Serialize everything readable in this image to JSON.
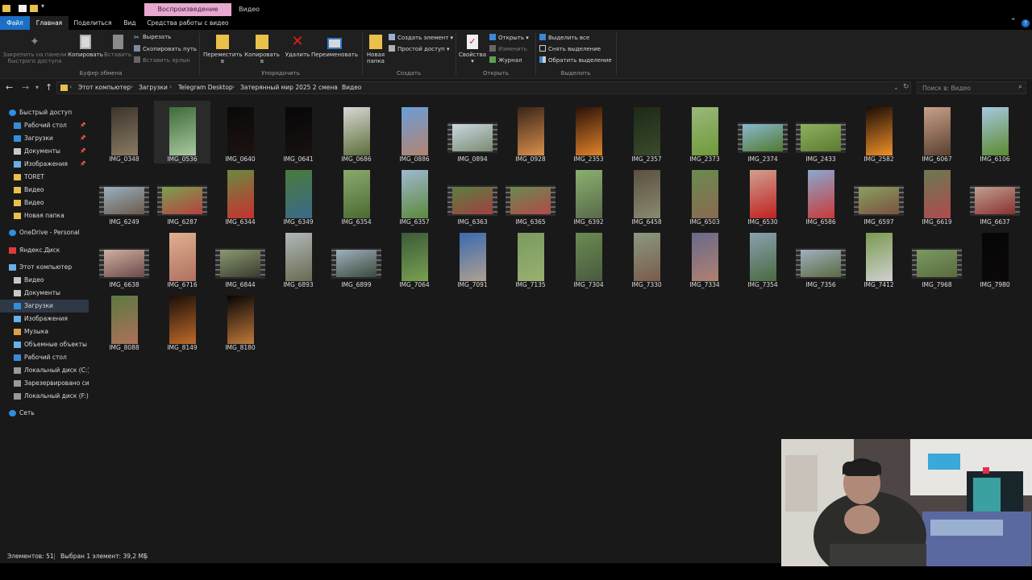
{
  "window": {
    "context_tab_group": "Воспроизведение",
    "context_tab_sub": "Видео"
  },
  "ribbon_tabs": [
    {
      "label": "Файл"
    },
    {
      "label": "Главная"
    },
    {
      "label": "Поделиться"
    },
    {
      "label": "Вид"
    },
    {
      "label": "Средства работы с видео"
    }
  ],
  "ribbon": {
    "clipboard": {
      "pin_label_1": "Закрепить на панели",
      "pin_label_2": "быстрого доступа",
      "copy": "Копировать",
      "paste": "Вставить",
      "cut": "Вырезать",
      "copy_path": "Скопировать путь",
      "paste_shortcut": "Вставить ярлык",
      "group": "Буфер обмена"
    },
    "organize": {
      "move_1": "Переместить",
      "move_2": "в",
      "copy_1": "Копировать",
      "copy_2": "в",
      "delete": "Удалить",
      "rename": "Переименовать",
      "group": "Упорядочить"
    },
    "create": {
      "new_folder_1": "Новая",
      "new_folder_2": "папка",
      "new_item": "Создать элемент",
      "easy_access": "Простой доступ",
      "group": "Создать"
    },
    "open": {
      "properties": "Свойства",
      "open": "Открыть",
      "edit": "Изменить",
      "history": "Журнал",
      "group": "Открыть"
    },
    "select": {
      "select_all": "Выделить все",
      "select_none": "Снять выделение",
      "invert": "Обратить выделение",
      "group": "Выделить"
    }
  },
  "address": {
    "crumbs": [
      "Этот компьютер",
      "Загрузки",
      "Telegram Desktop",
      "Затерянный мир 2025 2 смена",
      "Видео"
    ],
    "search_placeholder": "Поиск в: Видео"
  },
  "nav": [
    {
      "label": "Быстрый доступ",
      "icon": "star-icon"
    },
    {
      "label": "Рабочий стол",
      "icon": "desktop-icon",
      "pinned": true
    },
    {
      "label": "Загрузки",
      "icon": "download-icon",
      "pinned": true
    },
    {
      "label": "Документы",
      "icon": "documents-icon",
      "pinned": true
    },
    {
      "label": "Изображения",
      "icon": "pictures-icon",
      "pinned": true
    },
    {
      "label": "TORET",
      "icon": "folder-icon"
    },
    {
      "label": "Видео",
      "icon": "folder-icon"
    },
    {
      "label": "Видео",
      "icon": "folder-icon"
    },
    {
      "label": "Новая папка",
      "icon": "folder-icon"
    },
    {
      "label": "OneDrive - Personal",
      "icon": "cloud-icon"
    },
    {
      "label": "Яндекс.Диск",
      "icon": "yandex-disk-icon"
    },
    {
      "label": "Этот компьютер",
      "icon": "computer-icon"
    },
    {
      "label": "Видео",
      "icon": "videos-icon"
    },
    {
      "label": "Документы",
      "icon": "documents-icon"
    },
    {
      "label": "Загрузки",
      "icon": "download-icon",
      "selected": true
    },
    {
      "label": "Изображения",
      "icon": "pictures-icon"
    },
    {
      "label": "Музыка",
      "icon": "music-icon"
    },
    {
      "label": "Объемные объекты",
      "icon": "3d-objects-icon"
    },
    {
      "label": "Рабочий стол",
      "icon": "desktop-icon"
    },
    {
      "label": "Локальный диск (C:)",
      "icon": "drive-icon"
    },
    {
      "label": "Зарезервировано системой (D:)",
      "icon": "drive-icon"
    },
    {
      "label": "Локальный диск (F:)",
      "icon": "drive-icon"
    },
    {
      "label": "Сеть",
      "icon": "network-icon"
    }
  ],
  "files": [
    {
      "name": "IMG_0348",
      "kind": "port",
      "c1": "#3c352c",
      "c2": "#8a7a62"
    },
    {
      "name": "IMG_0536",
      "kind": "port",
      "c1": "#3d6b3a",
      "c2": "#a9c9a0",
      "selected": true
    },
    {
      "name": "IMG_0640",
      "kind": "port",
      "c1": "#0a0808",
      "c2": "#1c1410"
    },
    {
      "name": "IMG_0641",
      "kind": "port",
      "c1": "#070707",
      "c2": "#181210"
    },
    {
      "name": "IMG_0686",
      "kind": "port",
      "c1": "#d8d8d4",
      "c2": "#5b6e3a"
    },
    {
      "name": "IMG_0886",
      "kind": "port",
      "c1": "#6a9ed6",
      "c2": "#b48470"
    },
    {
      "name": "IMG_0894",
      "kind": "land",
      "c1": "#c9d8e2",
      "c2": "#7a8a70"
    },
    {
      "name": "IMG_0928",
      "kind": "port",
      "c1": "#3a2418",
      "c2": "#d8904c"
    },
    {
      "name": "IMG_2353",
      "kind": "port",
      "c1": "#2a1208",
      "c2": "#e0822a"
    },
    {
      "name": "IMG_2357",
      "kind": "port",
      "c1": "#1c2a18",
      "c2": "#3a4a2a"
    },
    {
      "name": "IMG_2373",
      "kind": "port",
      "c1": "#9ab87a",
      "c2": "#6f9a3a"
    },
    {
      "name": "IMG_2374",
      "kind": "land",
      "c1": "#8ab8d0",
      "c2": "#4f7a2e"
    },
    {
      "name": "IMG_2433",
      "kind": "land",
      "c1": "#90b060",
      "c2": "#5a7a30"
    },
    {
      "name": "IMG_2582",
      "kind": "port",
      "c1": "#1a0c04",
      "c2": "#f0902a"
    },
    {
      "name": "IMG_6067",
      "kind": "port",
      "c1": "#c8a08a",
      "c2": "#5a4030"
    },
    {
      "name": "IMG_6106",
      "kind": "port",
      "c1": "#a8c8e0",
      "c2": "#5a8a30"
    },
    {
      "name": "IMG_6249",
      "kind": "land",
      "c1": "#9ab0c0",
      "c2": "#6a5a4a"
    },
    {
      "name": "IMG_6287",
      "kind": "land",
      "c1": "#7aa050",
      "c2": "#b84040"
    },
    {
      "name": "IMG_6344",
      "kind": "port",
      "c1": "#6a8a40",
      "c2": "#c83030"
    },
    {
      "name": "IMG_6349",
      "kind": "port",
      "c1": "#4a7a3a",
      "c2": "#3a6a8a"
    },
    {
      "name": "IMG_6354",
      "kind": "port",
      "c1": "#8aaa70",
      "c2": "#4a6a30"
    },
    {
      "name": "IMG_6357",
      "kind": "port",
      "c1": "#a0b8d0",
      "c2": "#5a8a3a"
    },
    {
      "name": "IMG_6363",
      "kind": "land",
      "c1": "#5a8040",
      "c2": "#a04040"
    },
    {
      "name": "IMG_6365",
      "kind": "land",
      "c1": "#6a8a50",
      "c2": "#b04a4a"
    },
    {
      "name": "IMG_6392",
      "kind": "port",
      "c1": "#8ab070",
      "c2": "#5a6a4a"
    },
    {
      "name": "IMG_6458",
      "kind": "port",
      "c1": "#5a5040",
      "c2": "#8a8a70"
    },
    {
      "name": "IMG_6503",
      "kind": "port",
      "c1": "#6a8a50",
      "c2": "#8a6a50"
    },
    {
      "name": "IMG_6530",
      "kind": "port",
      "c1": "#d0a090",
      "c2": "#c02020"
    },
    {
      "name": "IMG_6586",
      "kind": "port",
      "c1": "#8aa8d0",
      "c2": "#c83a3a"
    },
    {
      "name": "IMG_6597",
      "kind": "land",
      "c1": "#8aa060",
      "c2": "#7a5040"
    },
    {
      "name": "IMG_6619",
      "kind": "port",
      "c1": "#6a7a50",
      "c2": "#b04a50"
    },
    {
      "name": "IMG_6637",
      "kind": "land",
      "c1": "#c0a090",
      "c2": "#8a3030"
    },
    {
      "name": "IMG_6638",
      "kind": "land",
      "c1": "#d0b0a0",
      "c2": "#6a4a4a"
    },
    {
      "name": "IMG_6716",
      "kind": "port",
      "c1": "#e0b090",
      "c2": "#b07060"
    },
    {
      "name": "IMG_6844",
      "kind": "land",
      "c1": "#8a9a70",
      "c2": "#3a3a30"
    },
    {
      "name": "IMG_6893",
      "kind": "port",
      "c1": "#b0b8b8",
      "c2": "#6a6a50"
    },
    {
      "name": "IMG_6899",
      "kind": "land",
      "c1": "#a0b0c0",
      "c2": "#3a4a3a"
    },
    {
      "name": "IMG_7064",
      "kind": "port",
      "c1": "#3a5a3a",
      "c2": "#7aa050"
    },
    {
      "name": "IMG_7091",
      "kind": "port",
      "c1": "#3a6ab0",
      "c2": "#b0a090"
    },
    {
      "name": "IMG_7135",
      "kind": "port",
      "c1": "#7a9a60",
      "c2": "#9ab070"
    },
    {
      "name": "IMG_7304",
      "kind": "port",
      "c1": "#6a8a50",
      "c2": "#4a5a40"
    },
    {
      "name": "IMG_7330",
      "kind": "port",
      "c1": "#8a9a80",
      "c2": "#7a5a4a"
    },
    {
      "name": "IMG_7334",
      "kind": "port",
      "c1": "#6a6a8a",
      "c2": "#b08070"
    },
    {
      "name": "IMG_7354",
      "kind": "port",
      "c1": "#8aa0b0",
      "c2": "#4a6a40"
    },
    {
      "name": "IMG_7356",
      "kind": "land",
      "c1": "#a0b0c0",
      "c2": "#5a6a40"
    },
    {
      "name": "IMG_7412",
      "kind": "port",
      "c1": "#7a9a50",
      "c2": "#d0d0d0"
    },
    {
      "name": "IMG_7968",
      "kind": "land",
      "c1": "#7a9a60",
      "c2": "#5a6a40"
    },
    {
      "name": "IMG_7980",
      "kind": "port",
      "c1": "#060606",
      "c2": "#0c0808"
    },
    {
      "name": "IMG_8088",
      "kind": "port",
      "c1": "#5a7a40",
      "c2": "#b0705a"
    },
    {
      "name": "IMG_8149",
      "kind": "port",
      "c1": "#1a0e08",
      "c2": "#c06a2a"
    },
    {
      "name": "IMG_8180",
      "kind": "port",
      "c1": "#060404",
      "c2": "#c07a3a"
    }
  ],
  "status": {
    "count": "Элементов: 51",
    "selection": "Выбран 1 элемент: 39,2 МБ"
  },
  "colors": {
    "accent": "#1b6fc5",
    "context_tab": "#e7a9d0",
    "background": "#191919"
  }
}
